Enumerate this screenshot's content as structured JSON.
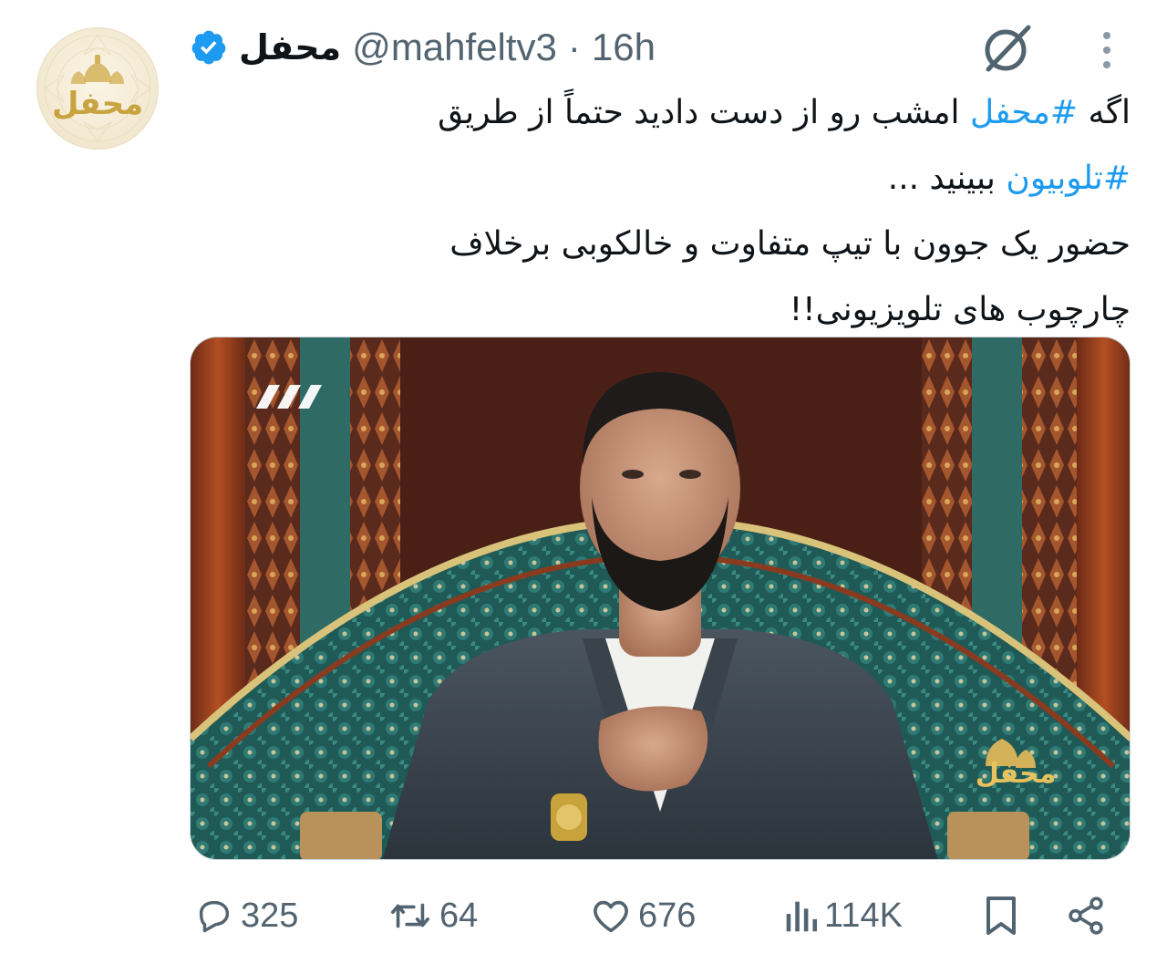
{
  "author": {
    "display_name": "محفل",
    "handle": "@mahfeltv3",
    "separator": "·",
    "time_ago": "16h",
    "avatar_logo_text": "محفل",
    "verified": true
  },
  "tweet": {
    "lines": [
      [
        {
          "text": "اگه ",
          "hashtag": false
        },
        {
          "text": "#محفل",
          "hashtag": true
        },
        {
          "text": " امشب رو از دست دادید حتماً از طریق",
          "hashtag": false
        }
      ],
      [
        {
          "text": "#تلوبیون",
          "hashtag": true
        },
        {
          "text": " ببینید ...",
          "hashtag": false
        }
      ],
      [
        {
          "text": "حضور یک جوون با تیپ متفاوت و خالکوبی برخلاف",
          "hashtag": false
        }
      ],
      [
        {
          "text": "چارچوب های تلویزیونی!!",
          "hashtag": false
        }
      ]
    ]
  },
  "media": {
    "kind": "video-still",
    "channel_logo_text": "محفل",
    "channel_number_icon": "channel-3-logo"
  },
  "actions": {
    "replies": "325",
    "reposts": "64",
    "likes": "676",
    "views": "114K"
  },
  "icons": {
    "verified": "verified-badge-icon",
    "grok": "grok-icon",
    "more": "more-vertical-icon",
    "reply": "reply-icon",
    "repost": "repost-icon",
    "like": "heart-icon",
    "views": "views-icon",
    "bookmark": "bookmark-icon",
    "share": "share-icon"
  },
  "colors": {
    "accent": "#1d9bf0",
    "secondary_text": "#536471",
    "primary_text": "#0f1419",
    "logo_gold": "#c9a33f"
  }
}
